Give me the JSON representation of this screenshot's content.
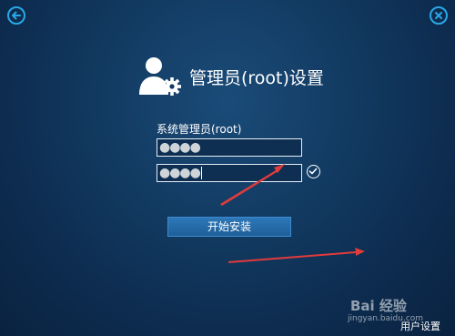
{
  "header": {
    "back_icon": "back-arrow-icon",
    "close_icon": "close-icon",
    "title": "管理员(root)设置"
  },
  "form": {
    "field_label": "系统管理员(root)",
    "password_value": "●●●●",
    "confirm_value": "●●●●",
    "confirm_status_icon": "check-circle-icon"
  },
  "actions": {
    "install_label": "开始安装"
  },
  "watermark": {
    "brand": "Bai 经验",
    "url": "jingyan.baidu.com"
  },
  "caption": "用户设置",
  "colors": {
    "accent": "#2aa7e6",
    "button": "#2d78b8",
    "annotation_arrow": "#e23b3b"
  }
}
